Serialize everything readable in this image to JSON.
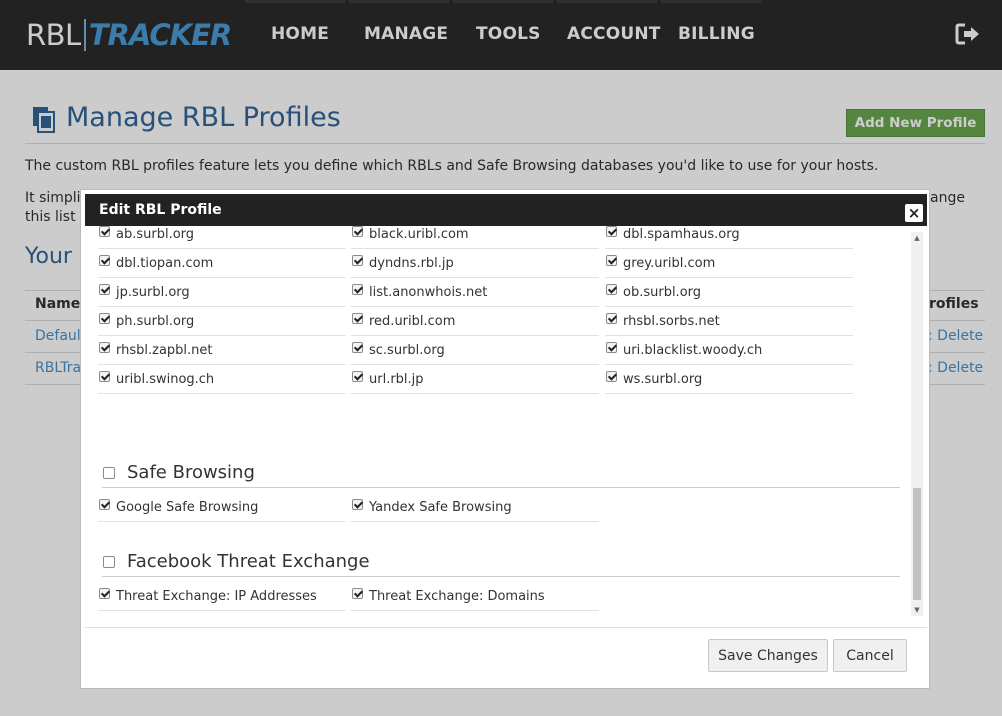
{
  "nav": {
    "logo_rbl": "RBL",
    "logo_tracker": "TRACKER",
    "items": [
      "HOME",
      "MANAGE",
      "TOOLS",
      "ACCOUNT",
      "BILLING"
    ],
    "logout_icon": "logout-icon"
  },
  "page": {
    "title": "Manage RBL Profiles",
    "add_button": "Add New Profile",
    "intro": "The custom RBL profiles feature lets you define which RBLs and Safe Browsing databases you'd like to use for your hosts.",
    "intro2_start": "It simplif",
    "intro2_line2": "this list la",
    "intro2_end": "ange",
    "your_heading": "Your",
    "table": {
      "col_name": "Name",
      "col_profiles": "rofiles",
      "rows": [
        {
          "name": "Default",
          "action": ": Delete"
        },
        {
          "name": "RBLTra",
          "action": ": Delete"
        }
      ]
    }
  },
  "modal": {
    "title": "Edit RBL Profile",
    "close_label": "×",
    "rbl_items": [
      {
        "label": "ab.surbl.org",
        "checked": true
      },
      {
        "label": "black.uribl.com",
        "checked": true
      },
      {
        "label": "dbl.spamhaus.org",
        "checked": true
      },
      {
        "label": "dbl.tiopan.com",
        "checked": true
      },
      {
        "label": "dyndns.rbl.jp",
        "checked": true
      },
      {
        "label": "grey.uribl.com",
        "checked": true
      },
      {
        "label": "jp.surbl.org",
        "checked": true
      },
      {
        "label": "list.anonwhois.net",
        "checked": true
      },
      {
        "label": "ob.surbl.org",
        "checked": true
      },
      {
        "label": "ph.surbl.org",
        "checked": true
      },
      {
        "label": "red.uribl.com",
        "checked": true
      },
      {
        "label": "rhsbl.sorbs.net",
        "checked": true
      },
      {
        "label": "rhsbl.zapbl.net",
        "checked": true
      },
      {
        "label": "sc.surbl.org",
        "checked": true
      },
      {
        "label": "uri.blacklist.woody.ch",
        "checked": true
      },
      {
        "label": "uribl.swinog.ch",
        "checked": true
      },
      {
        "label": "url.rbl.jp",
        "checked": true
      },
      {
        "label": "ws.surbl.org",
        "checked": true
      }
    ],
    "safe_browsing": {
      "title": "Safe Browsing",
      "checked": false,
      "items": [
        {
          "label": "Google Safe Browsing",
          "checked": true
        },
        {
          "label": "Yandex Safe Browsing",
          "checked": true
        }
      ]
    },
    "threat_exchange": {
      "title": "Facebook Threat Exchange",
      "checked": false,
      "items": [
        {
          "label": "Threat Exchange: IP Addresses",
          "checked": true
        },
        {
          "label": "Threat Exchange: Domains",
          "checked": true
        }
      ]
    },
    "save_label": "Save Changes",
    "cancel_label": "Cancel"
  }
}
